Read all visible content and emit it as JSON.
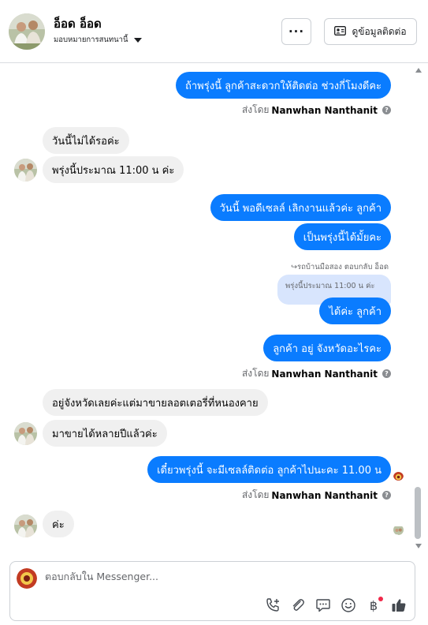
{
  "header": {
    "name": "อ็อด อ็อด",
    "subtitle": "มอบหมายการสนทนานี้",
    "more_label": "···",
    "contact_button_label": "ดูข้อมูลติดต่อ"
  },
  "messages": [
    {
      "side": "out",
      "text": "ถ้าพรุ่งนี้ ลูกค้าสะดวกให้ติดต่อ ช่วงกี่โมงดีคะ"
    },
    {
      "side": "in",
      "text": "วันนี้ไม่ได้รอค่ะ"
    },
    {
      "side": "in",
      "text": "พรุ่งนี้ประมาณ 11:00 น ค่ะ"
    },
    {
      "side": "out",
      "text": "วันนี้ พอดีเซลล์ เลิกงานแล้วค่ะ ลูกค้า"
    },
    {
      "side": "out",
      "text": "เป็นพรุ่งนี้ได้มั้ยคะ"
    },
    {
      "side": "out",
      "text": "ได้ค่ะ ลูกค้า"
    },
    {
      "side": "out",
      "text": "ลูกค้า อยู่ จังหวัดอะไรคะ"
    },
    {
      "side": "in",
      "text": "อยู่จังหวัดเลยค่ะแต่มาขายลอตเตอรี่ที่หนองคาย"
    },
    {
      "side": "in",
      "text": "มาขายได้หลายปีแล้วค่ะ"
    },
    {
      "side": "out",
      "text": "เดี๋ยวพรุ่งนี้ จะมีเซลล์ติดต่อ ลูกค้าไปนะคะ  11.00 น"
    },
    {
      "side": "in",
      "text": "ค่ะ"
    }
  ],
  "sent_by": {
    "prefix": "ส่งโดย",
    "name": "Nanwhan Nanthanit",
    "icon": "question-icon"
  },
  "reply": {
    "label": "รถบ้านมือสอง ตอบกลับ อ็อด",
    "quoted_text": "พรุ่งนี้ประมาณ 11:00 น ค่ะ"
  },
  "composer": {
    "placeholder": "ตอบกลับใน Messenger...",
    "tools": [
      "phone-plus-icon",
      "paperclip-icon",
      "comment-icon",
      "smiley-icon",
      "baht-icon",
      "thumbs-up-icon"
    ]
  },
  "colors": {
    "outgoing": "#0a7cff",
    "incoming": "#f0f0f0",
    "quote_bg": "#d8e5fd",
    "notification_dot": "#f02849"
  }
}
